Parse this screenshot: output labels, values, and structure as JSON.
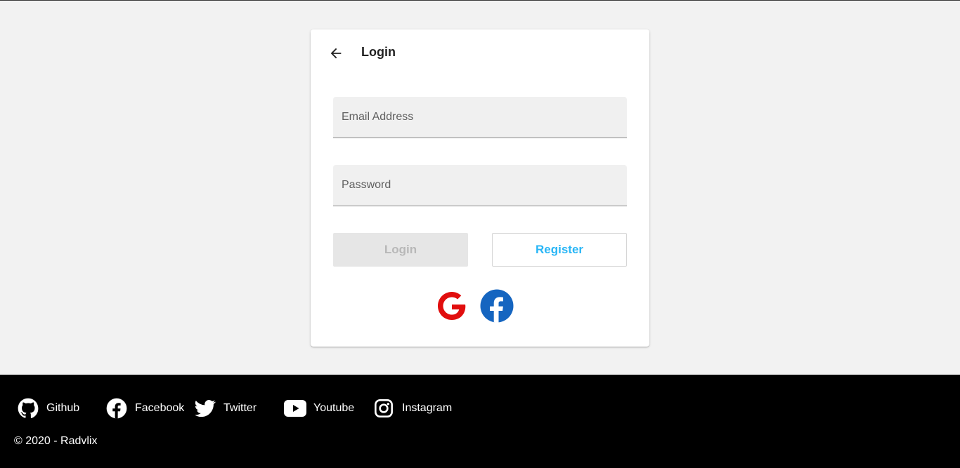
{
  "login_card": {
    "title": "Login",
    "email_placeholder": "Email Address",
    "password_placeholder": "Password",
    "login_button": "Login",
    "register_button": "Register",
    "social": [
      {
        "name": "google",
        "icon": "google-icon",
        "color": "#e10e0e"
      },
      {
        "name": "facebook",
        "icon": "facebook-icon",
        "color": "#1877f2"
      }
    ]
  },
  "footer": {
    "links": [
      {
        "label": "Github",
        "icon": "github-icon"
      },
      {
        "label": "Facebook",
        "icon": "facebook-icon"
      },
      {
        "label": "Twitter",
        "icon": "twitter-icon"
      },
      {
        "label": "Youtube",
        "icon": "youtube-icon"
      },
      {
        "label": "Instagram",
        "icon": "instagram-icon"
      }
    ],
    "copyright": "© 2020 - Radvlix"
  },
  "colors": {
    "accent": "#29b6f6",
    "page_background": "#f2f2f2",
    "footer_background": "#000000"
  }
}
